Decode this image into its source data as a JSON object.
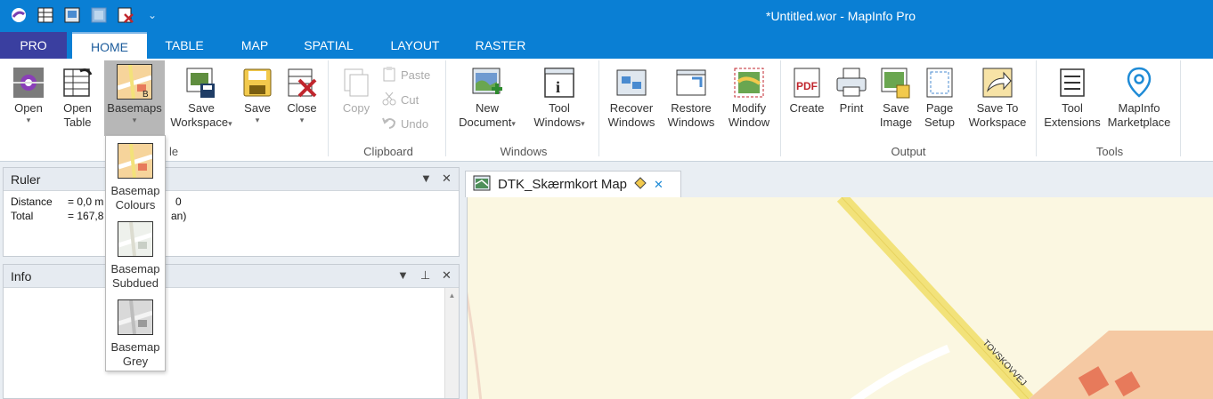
{
  "window": {
    "title": "*Untitled.wor - MapInfo Pro"
  },
  "qat": {
    "icons": [
      "mapinfo-logo-icon",
      "open-table-icon",
      "open-workspace-icon",
      "layout-icon",
      "close-table-icon",
      "more-icon"
    ],
    "more_glyph": "⌄"
  },
  "tabs": [
    "PRO",
    "HOME",
    "TABLE",
    "MAP",
    "SPATIAL",
    "LAYOUT",
    "RASTER"
  ],
  "ribbon": {
    "open": "Open",
    "open_table_1": "Open",
    "open_table_2": "Table",
    "basemaps": "Basemaps",
    "save_workspace_1": "Save",
    "save_workspace_2": "Workspace",
    "save": "Save",
    "close": "Close",
    "copy": "Copy",
    "paste": "Paste",
    "cut": "Cut",
    "undo": "Undo",
    "new_document_1": "New",
    "new_document_2": "Document",
    "tool_windows_1": "Tool",
    "tool_windows_2": "Windows",
    "recover_windows_1": "Recover",
    "recover_windows_2": "Windows",
    "restore_windows_1": "Restore",
    "restore_windows_2": "Windows",
    "modify_window_1": "Modify",
    "modify_window_2": "Window",
    "create": "Create",
    "print": "Print",
    "save_image_1": "Save",
    "save_image_2": "Image",
    "page_setup_1": "Page",
    "page_setup_2": "Setup",
    "save_to_workspace_1": "Save To",
    "save_to_workspace_2": "Workspace",
    "tool_extensions_1": "Tool",
    "tool_extensions_2": "Extensions",
    "mapinfo_marketplace_1": "MapInfo",
    "mapinfo_marketplace_2": "Marketplace",
    "group_file_partial": "le",
    "group_clipboard": "Clipboard",
    "group_windows": "Windows",
    "group_output": "Output",
    "group_tools": "Tools",
    "arrow_glyph": "▾"
  },
  "basemaps_menu": [
    {
      "line1": "Basemap",
      "line2": "Colours"
    },
    {
      "line1": "Basemap",
      "line2": "Subdued"
    },
    {
      "line1": "Basemap",
      "line2": "Grey"
    }
  ],
  "ruler": {
    "title": "Ruler",
    "distance_label": "Distance",
    "distance_value": "= 0,0 m",
    "distance_suffix": "0",
    "total_label": "Total",
    "total_value": "= 167,8",
    "total_suffix": "an)"
  },
  "info": {
    "title": "Info"
  },
  "map_tab": {
    "title": "DTK_Skærmkort Map",
    "close_glyph": "✕"
  },
  "map": {
    "road_label": "TOVSKOVVEJ"
  },
  "panel_controls": {
    "dropdown_glyph": "▼",
    "pin_glyph": "⊥",
    "close_glyph": "✕",
    "scroll_up_glyph": "▲"
  },
  "colors": {
    "titlebar": "#0a7fd4",
    "pro_tab": "#3a3fa0",
    "map_bg": "#fbf7e1",
    "road": "#f2e27a"
  }
}
